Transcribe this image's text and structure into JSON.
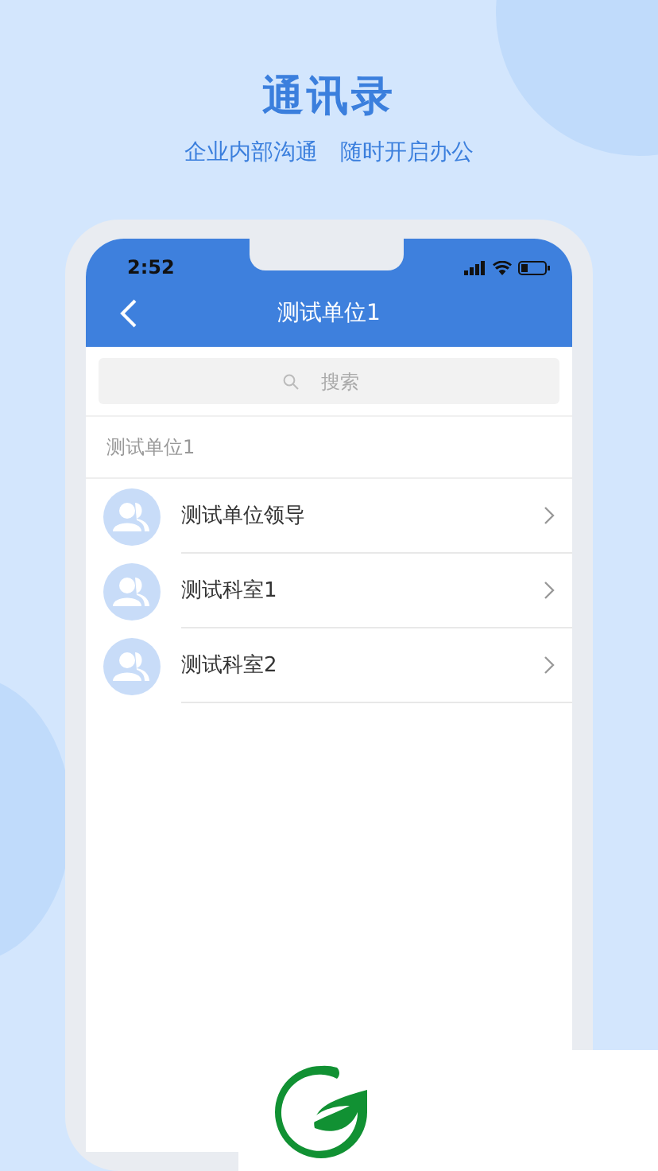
{
  "header": {
    "title": "通讯录",
    "subtitle": "企业内部沟通 随时开启办公"
  },
  "phone": {
    "status_bar": {
      "time": "2:52"
    },
    "nav_bar": {
      "title": "测试单位1"
    },
    "search": {
      "placeholder": "搜索"
    },
    "section": {
      "title": "测试单位1"
    },
    "contacts": [
      {
        "name": "测试单位领导"
      },
      {
        "name": "测试科室1"
      },
      {
        "name": "测试科室2"
      }
    ]
  }
}
